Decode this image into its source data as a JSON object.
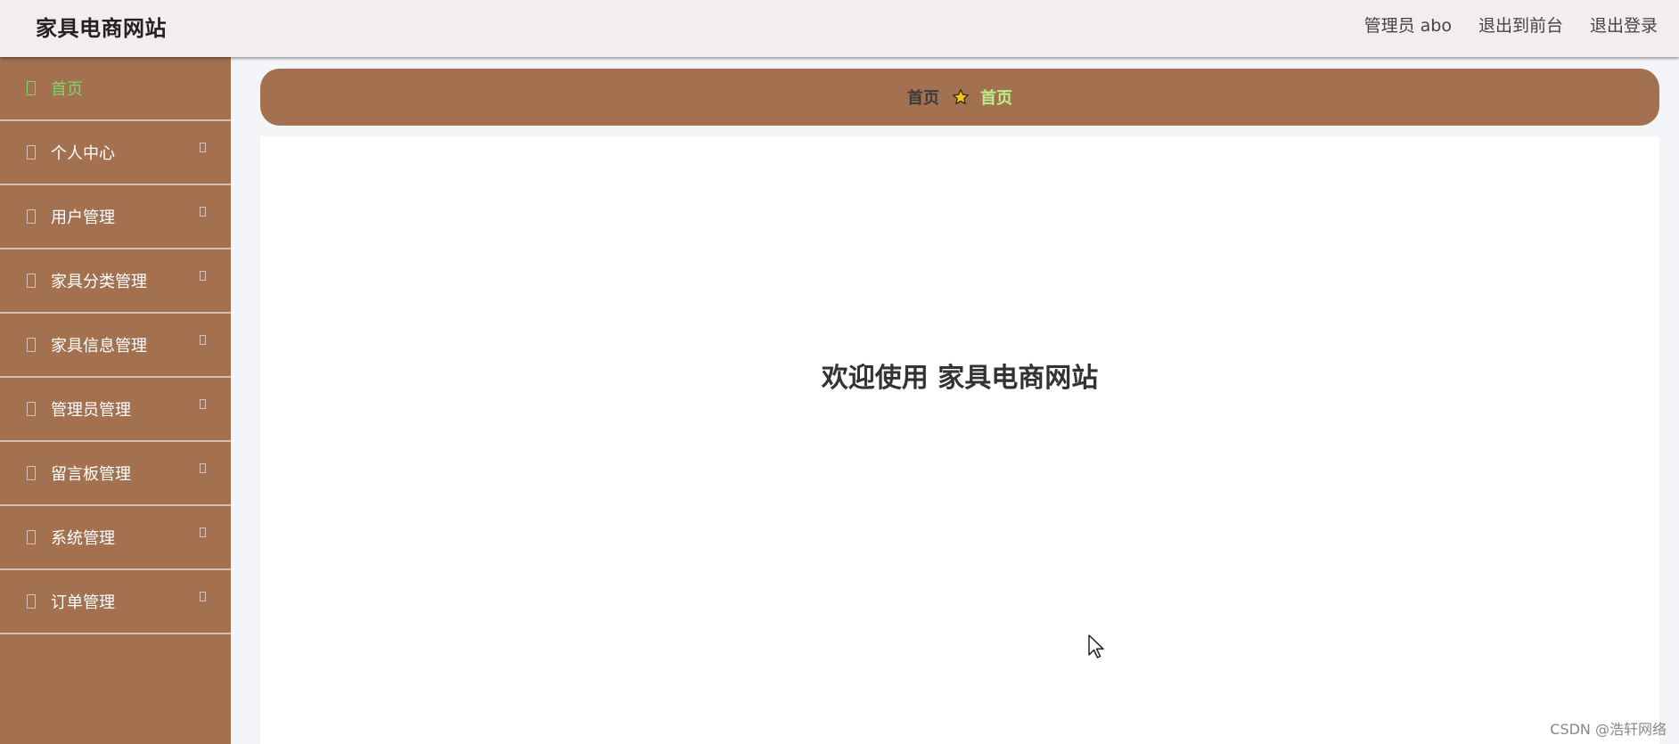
{
  "header": {
    "title": "家具电商网站",
    "user_label": "管理员 abo",
    "frontend_link": "退出到前台",
    "logout_link": "退出登录"
  },
  "sidebar": {
    "items": [
      {
        "label": "首页",
        "active": true
      },
      {
        "label": "个人中心"
      },
      {
        "label": "用户管理"
      },
      {
        "label": "家具分类管理"
      },
      {
        "label": "家具信息管理"
      },
      {
        "label": "管理员管理"
      },
      {
        "label": "留言板管理"
      },
      {
        "label": "系统管理"
      },
      {
        "label": "订单管理"
      }
    ]
  },
  "breadcrumb": {
    "home": "首页",
    "current": "首页"
  },
  "main": {
    "welcome": "欢迎使用 家具电商网站"
  },
  "watermark": "CSDN @浩轩网络",
  "colors": {
    "sidebar_bg": "#a37150",
    "active_text": "#7ed36a",
    "star": "#f5c518"
  }
}
